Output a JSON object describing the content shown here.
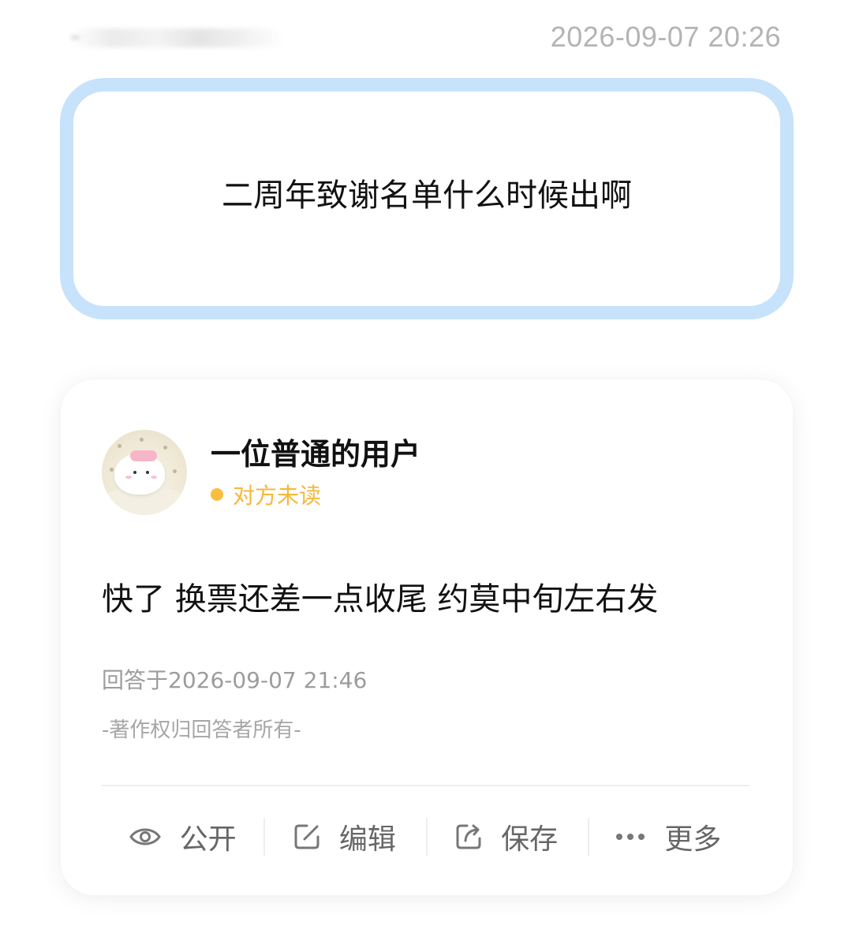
{
  "header": {
    "timestamp": "2026-09-07 20:26"
  },
  "question": {
    "text": "二周年致谢名单什么时候出啊"
  },
  "answer": {
    "username": "一位普通的用户",
    "status": "对方未读",
    "text": "快了 换票还差一点收尾 约莫中旬左右发",
    "answered_at": "回答于2026-09-07 21:46",
    "copyright": "-著作权归回答者所有-"
  },
  "actions": [
    {
      "label": "公开",
      "icon": "eye-icon"
    },
    {
      "label": "编辑",
      "icon": "edit-icon"
    },
    {
      "label": "保存",
      "icon": "share-icon"
    },
    {
      "label": "更多",
      "icon": "more-dots-icon"
    }
  ],
  "colors": {
    "question_border": "#c7e2fb",
    "status_dot": "#f9be3d",
    "status_text": "#f6b73c"
  }
}
